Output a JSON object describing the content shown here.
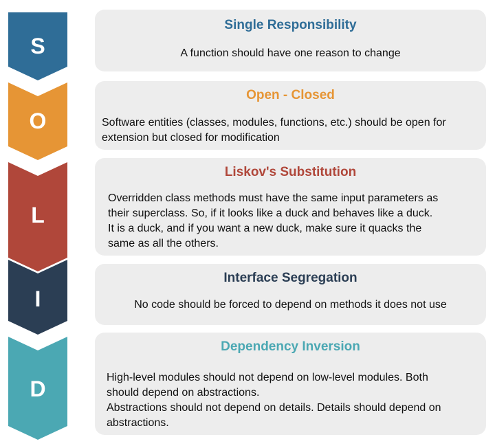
{
  "colors": {
    "s": "#2f6d97",
    "o": "#e69535",
    "l": "#b0473a",
    "i": "#2b3e54",
    "d": "#4ba8b3",
    "card_bg": "#ededed",
    "text": "#111111"
  },
  "principles": [
    {
      "letter": "S",
      "title": "Single Responsibility",
      "lines": [
        "A function should have one reason to change"
      ]
    },
    {
      "letter": "O",
      "title": "Open - Closed",
      "lines": [
        "Software entities (classes, modules, functions, etc.) should be open for",
        "extension but closed for modification"
      ]
    },
    {
      "letter": "L",
      "title": "Liskov's Substitution",
      "lines": [
        "Overridden class methods must have the same input parameters as",
        "their superclass. So, if it looks like a duck and behaves like a duck.",
        "It is a duck, and if you want a new duck, make sure it quacks the",
        "same as all the others."
      ]
    },
    {
      "letter": "I",
      "title": "Interface Segregation",
      "lines": [
        "No code should be forced to depend on methods it does not use"
      ]
    },
    {
      "letter": "D",
      "title": "Dependency Inversion",
      "lines": [
        "High-level modules should not depend on low-level modules. Both",
        "should depend on abstractions.",
        "Abstractions should not depend on details. Details should depend on",
        "abstractions."
      ]
    }
  ]
}
